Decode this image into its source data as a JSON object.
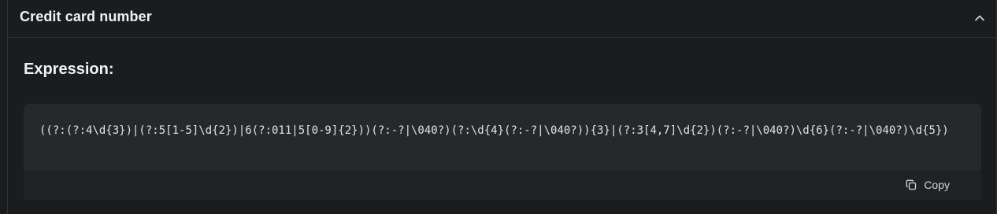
{
  "section": {
    "title": "Credit card number",
    "collapse_icon": "chevron-up-icon"
  },
  "expression": {
    "heading": "Expression:",
    "code": "((?:(?:4\\d{3})|(?:5[1-5]\\d{2})|6(?:011|5[0-9]{2}))(?:-?|\\040?)(?:\\d{4}(?:-?|\\040?)){3}|(?:3[4,7]\\d{2})(?:-?|\\040?)\\d{6}(?:-?|\\040?)\\d{5})",
    "copy_label": "Copy",
    "copy_icon": "copy-icon"
  }
}
